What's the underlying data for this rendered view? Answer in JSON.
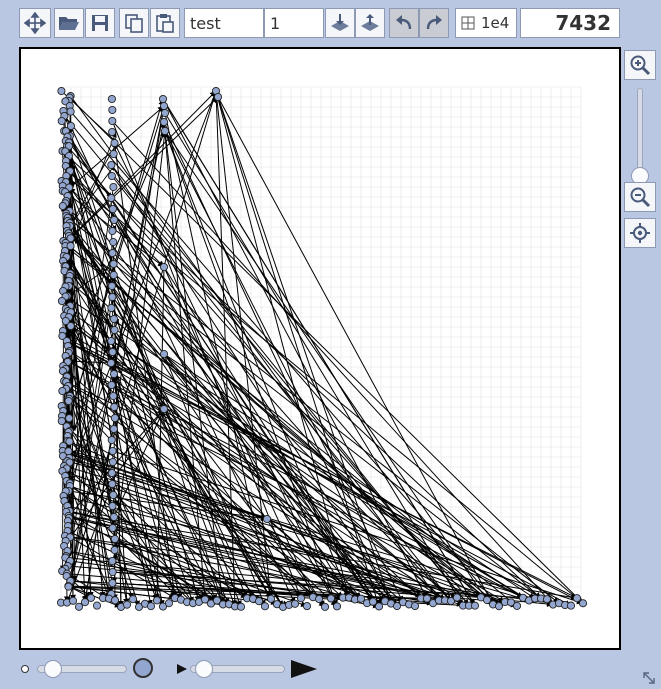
{
  "toolbar": {
    "move_icon": "move-icon",
    "open_icon": "folder-open-icon",
    "save_icon": "save-icon",
    "copy_icon": "copy-icon",
    "paste_icon": "paste-icon",
    "graph_name": "test",
    "layer_value": "1",
    "import_icon": "import-icon",
    "export_icon": "export-icon",
    "undo_icon": "undo-icon",
    "redo_icon": "redo-icon",
    "grid_label": "1e4",
    "counter": "7432"
  },
  "side": {
    "zoom_in_icon": "zoom-in-icon",
    "zoom_out_icon": "zoom-out-icon",
    "center_icon": "center-icon",
    "zoom_level": 0.0
  },
  "bottom": {
    "node_size_level": 0.18,
    "edge_size_level": 0.05
  },
  "colors": {
    "background": "#b9c7e2",
    "node_fill": "#93a6cf",
    "edge": "#000000",
    "grid": "#dfe3ea"
  }
}
